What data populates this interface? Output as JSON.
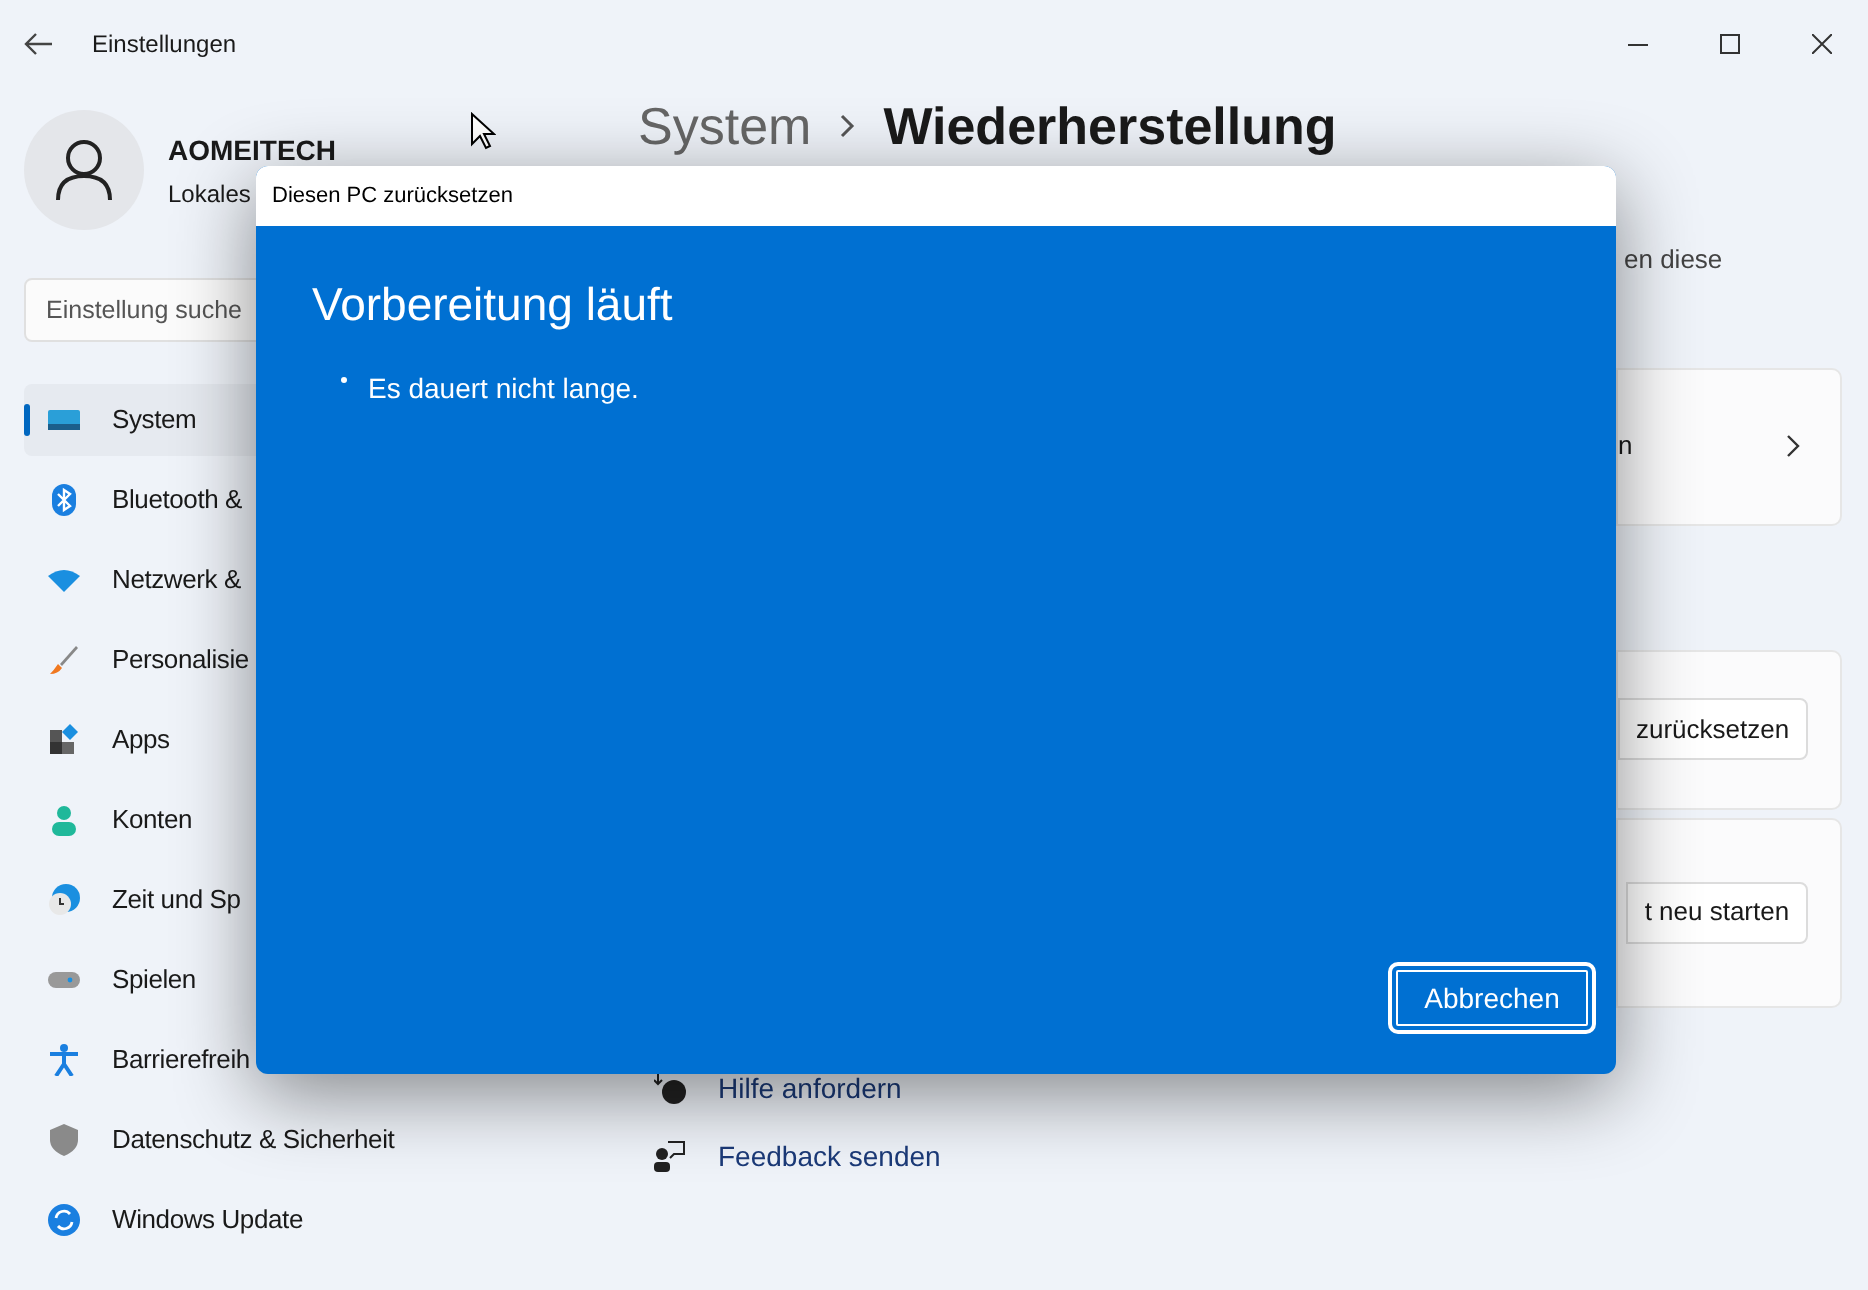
{
  "window": {
    "title": "Einstellungen"
  },
  "account": {
    "name": "AOMEITECH",
    "type": "Lokales"
  },
  "search": {
    "placeholder": "Einstellung suche"
  },
  "nav": [
    {
      "label": "System",
      "selected": true
    },
    {
      "label": "Bluetooth &",
      "selected": false
    },
    {
      "label": "Netzwerk &",
      "selected": false
    },
    {
      "label": "Personalisie",
      "selected": false
    },
    {
      "label": "Apps",
      "selected": false
    },
    {
      "label": "Konten",
      "selected": false
    },
    {
      "label": "Zeit und Sp",
      "selected": false
    },
    {
      "label": "Spielen",
      "selected": false
    },
    {
      "label": "Barrierefreih",
      "selected": false
    },
    {
      "label": "Datenschutz & Sicherheit",
      "selected": false
    },
    {
      "label": "Windows Update",
      "selected": false
    }
  ],
  "breadcrumb": {
    "parent": "System",
    "current": "Wiederherstellung"
  },
  "description": "en diese",
  "cards": [
    {
      "kind": "link",
      "text": "n"
    },
    {
      "kind": "button",
      "text": "zurücksetzen"
    },
    {
      "kind": "button",
      "text": "t neu starten"
    }
  ],
  "links": [
    {
      "label": "Hilfe anfordern"
    },
    {
      "label": "Feedback senden"
    }
  ],
  "dialog": {
    "title": "Diesen PC zurücksetzen",
    "heading": "Vorbereitung läuft",
    "status": "Es dauert nicht lange.",
    "button": "Abbrechen"
  }
}
